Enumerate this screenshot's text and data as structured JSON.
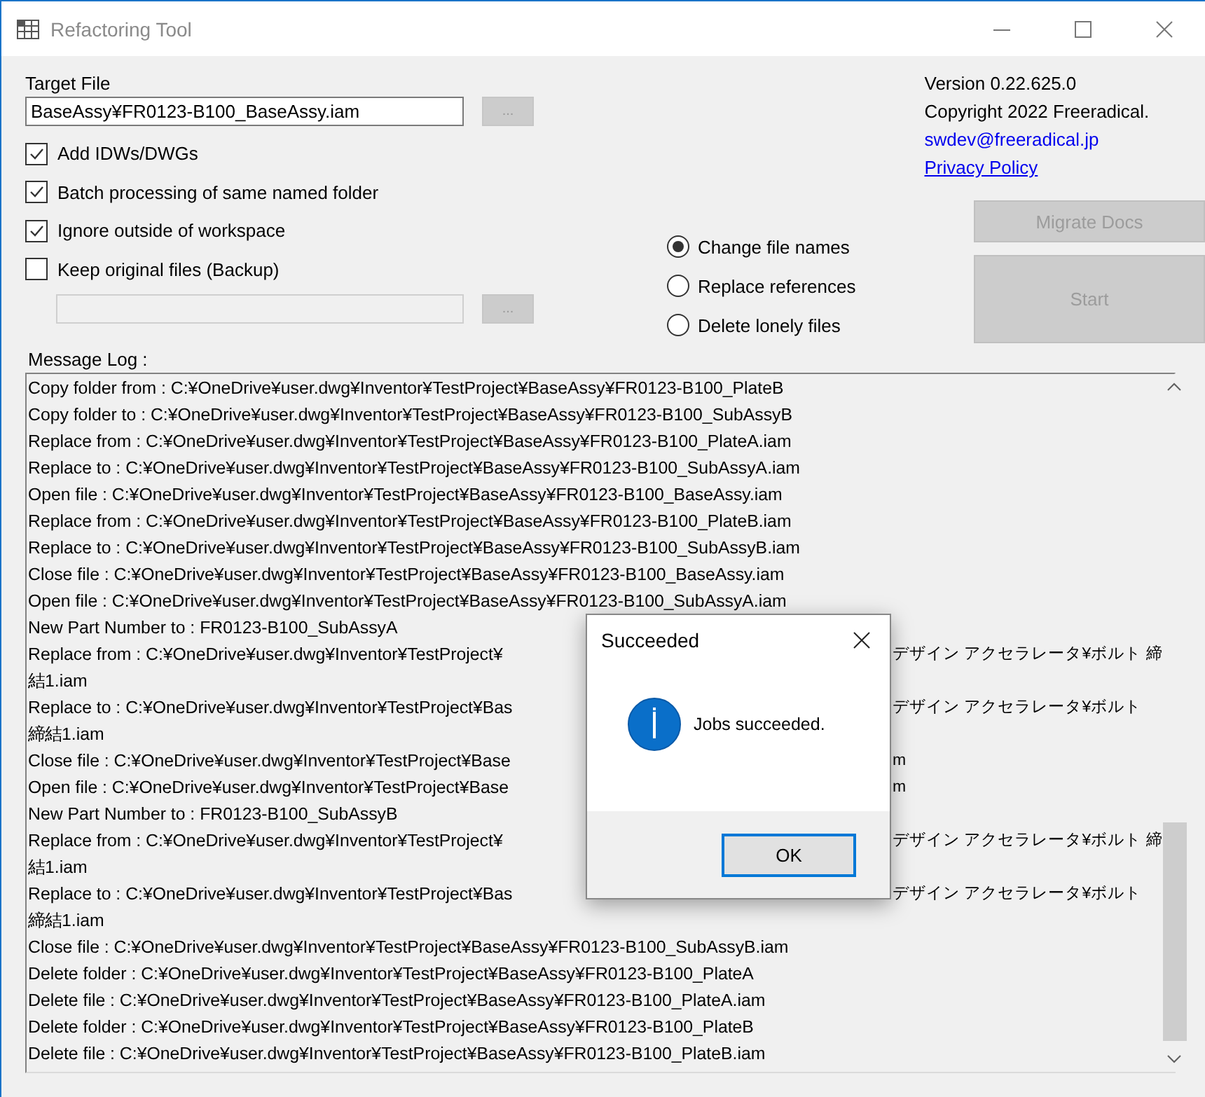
{
  "window": {
    "title": "Refactoring Tool"
  },
  "target_file": {
    "label": "Target File",
    "value": "BaseAssy¥FR0123-B100_BaseAssy.iam",
    "browse_button": "...",
    "browse_disabled": true
  },
  "options": [
    {
      "label": "Add IDWs/DWGs",
      "checked": true
    },
    {
      "label": "Batch processing of same named folder",
      "checked": true
    },
    {
      "label": "Ignore outside of workspace",
      "checked": true
    },
    {
      "label": "Keep original files (Backup)",
      "checked": false
    }
  ],
  "backup_folder": {
    "disabled": true,
    "browse_button": "...",
    "browse_disabled": true
  },
  "about": {
    "version": "Version 0.22.625.0",
    "copyright": "Copyright 2022 Freeradical.",
    "email": "swdev@freeradical.jp",
    "privacy_link": "Privacy Policy"
  },
  "modes": [
    {
      "label": "Change file names",
      "selected": true
    },
    {
      "label": "Replace references",
      "selected": false
    },
    {
      "label": "Delete lonely files",
      "selected": false
    }
  ],
  "buttons": [
    {
      "label": "Migrate Docs",
      "disabled": true
    },
    {
      "label": "Start",
      "disabled": true
    }
  ],
  "message_log": {
    "label": "Message Log :",
    "lines": [
      {
        "kind": "full",
        "text": "Copy folder from : C:¥OneDrive¥user.dwg¥Inventor¥TestProject¥BaseAssy¥FR0123-B100_PlateB"
      },
      {
        "kind": "full",
        "text": "Copy folder to : C:¥OneDrive¥user.dwg¥Inventor¥TestProject¥BaseAssy¥FR0123-B100_SubAssyB"
      },
      {
        "kind": "full",
        "text": "Replace from : C:¥OneDrive¥user.dwg¥Inventor¥TestProject¥BaseAssy¥FR0123-B100_PlateA.iam"
      },
      {
        "kind": "full",
        "text": "Replace to : C:¥OneDrive¥user.dwg¥Inventor¥TestProject¥BaseAssy¥FR0123-B100_SubAssyA.iam"
      },
      {
        "kind": "full",
        "text": "Open file : C:¥OneDrive¥user.dwg¥Inventor¥TestProject¥BaseAssy¥FR0123-B100_BaseAssy.iam"
      },
      {
        "kind": "full",
        "text": "Replace from : C:¥OneDrive¥user.dwg¥Inventor¥TestProject¥BaseAssy¥FR0123-B100_PlateB.iam"
      },
      {
        "kind": "full",
        "text": "Replace to : C:¥OneDrive¥user.dwg¥Inventor¥TestProject¥BaseAssy¥FR0123-B100_SubAssyB.iam"
      },
      {
        "kind": "full",
        "text": "Close file : C:¥OneDrive¥user.dwg¥Inventor¥TestProject¥BaseAssy¥FR0123-B100_BaseAssy.iam"
      },
      {
        "kind": "full",
        "text": "Open file : C:¥OneDrive¥user.dwg¥Inventor¥TestProject¥BaseAssy¥FR0123-B100_SubAssyA.iam"
      },
      {
        "kind": "full",
        "text": "New Part Number to : FR0123-B100_SubAssyA"
      },
      {
        "kind": "covered",
        "left": "Replace from : C:¥OneDrive¥user.dwg¥Inventor¥TestProject¥",
        "right": "デザイン アクセラレータ¥ボルト 締"
      },
      {
        "kind": "full",
        "text": "結1.iam"
      },
      {
        "kind": "covered",
        "left": "Replace to : C:¥OneDrive¥user.dwg¥Inventor¥TestProject¥Bas",
        "right": "デザイン アクセラレータ¥ボルト"
      },
      {
        "kind": "full",
        "text": "締結1.iam"
      },
      {
        "kind": "covered",
        "left": "Close file : C:¥OneDrive¥user.dwg¥Inventor¥TestProject¥Base",
        "right": "m"
      },
      {
        "kind": "covered",
        "left": "Open file : C:¥OneDrive¥user.dwg¥Inventor¥TestProject¥Base",
        "right": "m"
      },
      {
        "kind": "full",
        "text": "New Part Number to : FR0123-B100_SubAssyB"
      },
      {
        "kind": "covered",
        "left": "Replace from : C:¥OneDrive¥user.dwg¥Inventor¥TestProject¥",
        "right": "デザイン アクセラレータ¥ボルト 締"
      },
      {
        "kind": "full",
        "text": "結1.iam"
      },
      {
        "kind": "covered",
        "left": "Replace to : C:¥OneDrive¥user.dwg¥Inventor¥TestProject¥Bas",
        "right": "デザイン アクセラレータ¥ボルト"
      },
      {
        "kind": "full",
        "text": "締結1.iam"
      },
      {
        "kind": "full",
        "text": "Close file : C:¥OneDrive¥user.dwg¥Inventor¥TestProject¥BaseAssy¥FR0123-B100_SubAssyB.iam"
      },
      {
        "kind": "full",
        "text": "Delete folder : C:¥OneDrive¥user.dwg¥Inventor¥TestProject¥BaseAssy¥FR0123-B100_PlateA"
      },
      {
        "kind": "full",
        "text": "Delete file : C:¥OneDrive¥user.dwg¥Inventor¥TestProject¥BaseAssy¥FR0123-B100_PlateA.iam"
      },
      {
        "kind": "full",
        "text": "Delete folder : C:¥OneDrive¥user.dwg¥Inventor¥TestProject¥BaseAssy¥FR0123-B100_PlateB"
      },
      {
        "kind": "full",
        "text": "Delete file : C:¥OneDrive¥user.dwg¥Inventor¥TestProject¥BaseAssy¥FR0123-B100_PlateB.iam"
      }
    ]
  },
  "dialog": {
    "title": "Succeeded",
    "message": "Jobs succeeded.",
    "button": "OK"
  }
}
